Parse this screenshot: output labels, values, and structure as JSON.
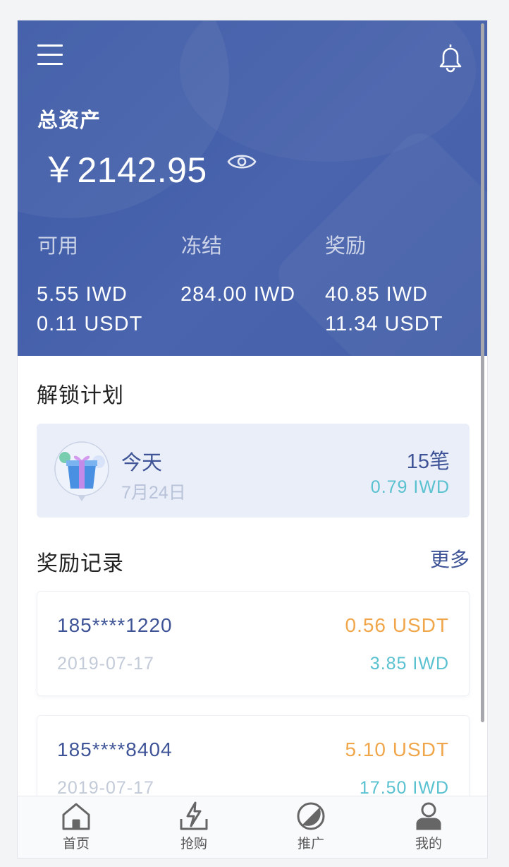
{
  "header": {
    "total_label": "总资产",
    "total_amount": "￥2142.95",
    "columns": [
      {
        "label": "可用",
        "values": [
          "5.55 IWD",
          "0.11 USDT"
        ]
      },
      {
        "label": "冻结",
        "values": [
          "284.00 IWD"
        ]
      },
      {
        "label": "奖励",
        "values": [
          "40.85 IWD",
          "11.34 USDT"
        ]
      }
    ]
  },
  "unlock": {
    "title": "解锁计划",
    "day": "今天",
    "date": "7月24日",
    "count": "15笔",
    "amount": "0.79 IWD"
  },
  "rewards": {
    "title": "奖励记录",
    "more": "更多",
    "records": [
      {
        "phone": "185****1220",
        "date": "2019-07-17",
        "usdt": "0.56 USDT",
        "iwd": "3.85 IWD"
      },
      {
        "phone": "185****8404",
        "date": "2019-07-17",
        "usdt": "5.10 USDT",
        "iwd": "17.50 IWD"
      }
    ]
  },
  "tabs": [
    {
      "label": "首页",
      "icon": "home-icon"
    },
    {
      "label": "抢购",
      "icon": "flash-buy-icon"
    },
    {
      "label": "推广",
      "icon": "promote-icon"
    },
    {
      "label": "我的",
      "icon": "profile-icon"
    }
  ],
  "colors": {
    "header_bg": "#4560a9",
    "accent": "#3f5497",
    "usdt": "#f0a74b",
    "iwd": "#59c1d0"
  }
}
